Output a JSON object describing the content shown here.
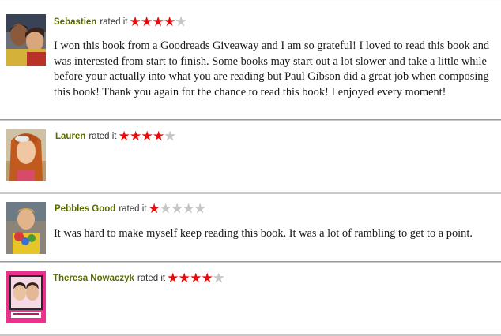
{
  "reviews": [
    {
      "name": "Sebastien",
      "rated_label": "rated it",
      "rating": 4,
      "max_rating": 5,
      "text": "I won this book from a Goodreads Giveaway and I am so grateful! I loved to read this book and was interested from start to finish. Some books may start out a lot slower and take a little while before your actually into what you are reading but Paul Gibson did a great job when composing this book! Thank you again for the chance to read this book! I enjoyed every moment!"
    },
    {
      "name": "Lauren",
      "rated_label": "rated it",
      "rating": 4,
      "max_rating": 5,
      "text": ""
    },
    {
      "name": "Pebbles Good",
      "rated_label": "rated it",
      "rating": 1,
      "max_rating": 5,
      "text": "It was hard to make myself keep reading this book. It was a lot of rambling to get to a point."
    },
    {
      "name": "Theresa Nowaczyk",
      "rated_label": "rated it",
      "rating": 4,
      "max_rating": 5,
      "text": ""
    }
  ],
  "colors": {
    "username": "#556b00",
    "star_on": "#e80a0a",
    "star_off": "#c6c6c6"
  },
  "icons": {
    "star_filled": "star-icon",
    "star_empty": "star-empty-icon"
  }
}
